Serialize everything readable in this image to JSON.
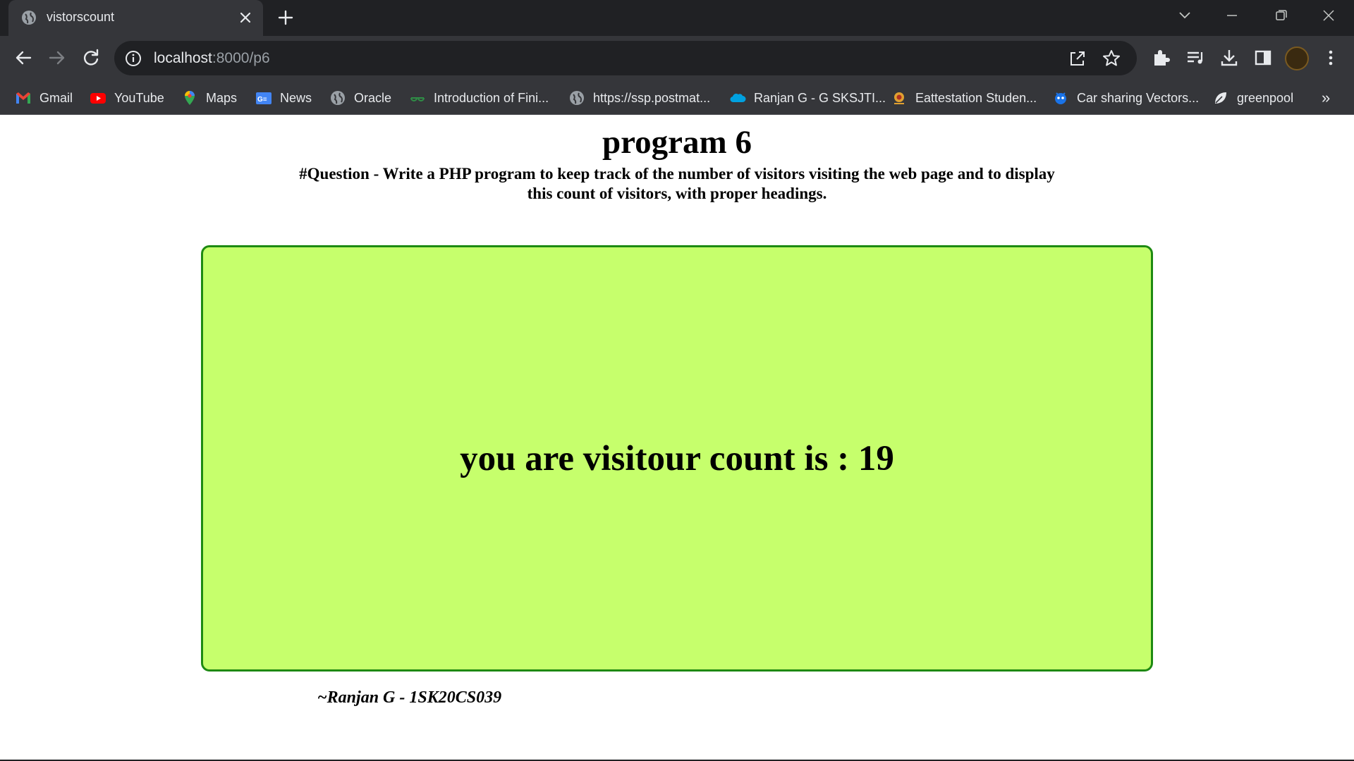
{
  "browser": {
    "tab": {
      "title": "vistorscount",
      "favicon": "globe-icon"
    },
    "url": {
      "host": "localhost",
      "path": ":8000/p6"
    },
    "bookmarks": [
      {
        "label": "Gmail",
        "icon": "gmail-icon"
      },
      {
        "label": "YouTube",
        "icon": "youtube-icon"
      },
      {
        "label": "Maps",
        "icon": "maps-icon"
      },
      {
        "label": "News",
        "icon": "news-icon"
      },
      {
        "label": "Oracle",
        "icon": "globe-icon"
      },
      {
        "label": "Introduction of Fini...",
        "icon": "gfg-icon"
      },
      {
        "label": "https://ssp.postmat...",
        "icon": "globe-icon"
      },
      {
        "label": "Ranjan G - G SKSJTI...",
        "icon": "salesforce-cloud-icon"
      },
      {
        "label": "Eattestation Studen...",
        "icon": "emblem-icon"
      },
      {
        "label": "Car sharing Vectors...",
        "icon": "vector-icon"
      },
      {
        "label": "greenpool",
        "icon": "leaf-icon"
      }
    ],
    "more_bookmarks": "»"
  },
  "page": {
    "heading": "program 6",
    "question_line1": "#Question - Write a PHP program to keep track of the number of visitors visiting the web page and to display",
    "question_line2": "this count of visitors, with proper headings.",
    "counter_text": "you are visitour count is : 19",
    "signature": "~Ranjan G - 1SK20CS039"
  },
  "colors": {
    "chrome_dark": "#202124",
    "chrome": "#35363a",
    "box_fill": "#c6ff6c",
    "box_border": "#1e8a12"
  }
}
